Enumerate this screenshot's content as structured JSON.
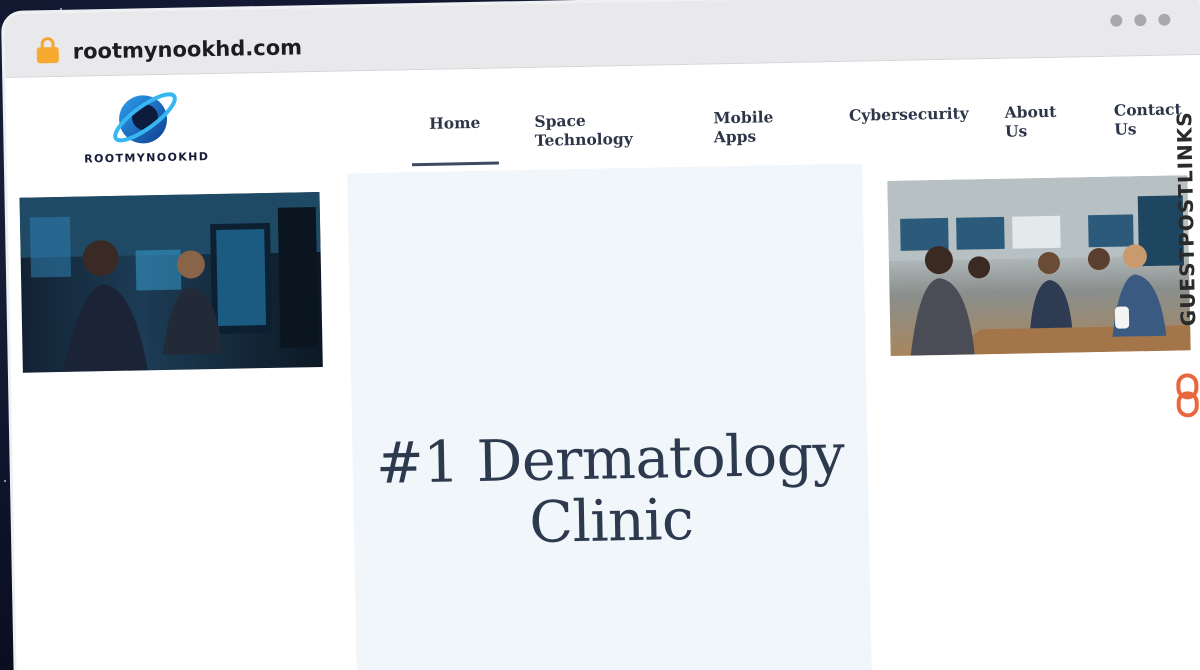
{
  "browser": {
    "url": "rootmynookhd.com"
  },
  "site": {
    "logo_text": "ROOTMYNOOKHD",
    "nav": [
      {
        "label": "Home",
        "active": true
      },
      {
        "label": "Space Technology",
        "active": false
      },
      {
        "label": "Mobile Apps",
        "active": false
      },
      {
        "label": "Cybersecurity",
        "active": false
      },
      {
        "label": "About Us",
        "active": false
      },
      {
        "label": "Contact Us",
        "active": false
      }
    ],
    "hero": {
      "title_line1": "#1 Dermatology",
      "title_line2": "Clinic"
    }
  },
  "watermark": {
    "text": "GUESTPOSTLINKS"
  },
  "colors": {
    "accent": "#3c4a62",
    "lock": "#f7a930",
    "hero_bg": "#f1f6fb",
    "brand_blue": "#1f7fd0"
  }
}
